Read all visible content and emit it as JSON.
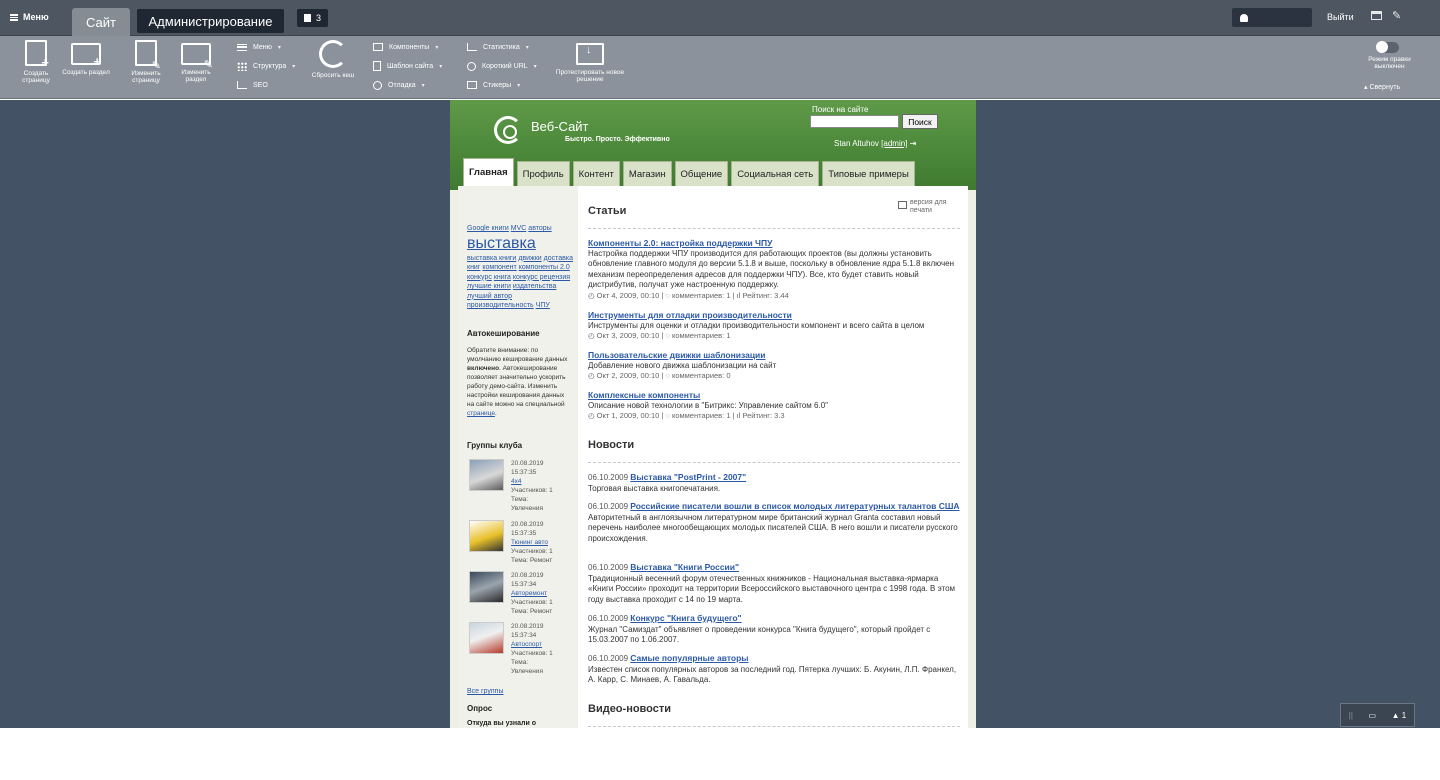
{
  "admin_bar": {
    "menu_label": "Меню",
    "tab_site": "Сайт",
    "tab_admin": "Администрирование",
    "notifications_count": "3",
    "logout": "Выйти"
  },
  "toolbar": {
    "create_page": "Создать страницу",
    "create_section": "Создать раздел",
    "edit_page": "Изменить страницу",
    "edit_section": "Изменить раздел",
    "menu": "Меню",
    "structure": "Структура",
    "seo": "SEO",
    "reset_cache": "Сбросить кеш",
    "components": "Компоненты",
    "site_template": "Шаблон сайта",
    "debug": "Отладка",
    "statistics": "Статистика",
    "short_url": "Короткий URL",
    "stickers": "Стикеры",
    "test_solution": "Протестировать новое решение",
    "edit_mode": "Режим правки выключен",
    "collapse": "Свернуть"
  },
  "site": {
    "name": "Веб-Сайт",
    "slogan": "Быстро. Просто. Эффективно",
    "search_label": "Поиск на сайте",
    "search_button": "Поиск",
    "user_name": "Stan Altuhov",
    "user_login": "[admin]",
    "tabs": [
      "Главная",
      "Профиль",
      "Контент",
      "Магазин",
      "Общение",
      "Социальная сеть",
      "Типовые примеры"
    ]
  },
  "left": {
    "tags_line1": [
      "Google книги",
      "MVC",
      "авторы"
    ],
    "tag_big": "выставка",
    "tags_rest": [
      "выставка книги",
      "движки",
      "доставка книг",
      "компонент",
      "компоненты 2.0",
      "конкурс",
      "книга",
      "конкурс рецензия",
      "лучшие книги",
      "издательства",
      "лучший автор",
      "производительность",
      "ЧПУ"
    ],
    "autocache_title": "Автокеширование",
    "autocache_text_pre": "Обратите внимание: по умолчанию кеширование данных ",
    "autocache_bold": "включено",
    "autocache_text_post": ". Автокеширование позволяет значительно ускорить работу демо-сайта. Изменить настройки кеширования данных на сайте можно на специальной ",
    "autocache_link": "странице",
    "groups_title": "Группы клуба",
    "groups": [
      {
        "date": "20.08.2019",
        "time": "15:37:35",
        "name": "4x4",
        "members": "Участников: 1",
        "theme_label": "Тема:",
        "theme": "Увлечения"
      },
      {
        "date": "20.08.2019",
        "time": "15:37:35",
        "name": "Тюнинг авто",
        "members": "Участников: 1",
        "theme_label": "Тема:",
        "theme": "Ремонт"
      },
      {
        "date": "20.08.2019",
        "time": "15:37:34",
        "name": "Авторемонт",
        "members": "Участников: 1",
        "theme_label": "Тема:",
        "theme": "Ремонт"
      },
      {
        "date": "20.08.2019",
        "time": "15:37:34",
        "name": "Автоспорт",
        "members": "Участников: 1",
        "theme_label": "Тема:",
        "theme": "Увлечения"
      }
    ],
    "all_groups": "Все группы",
    "poll_title": "Опрос",
    "poll_question": "Откуда вы узнали о"
  },
  "right": {
    "articles_title": "Статьи",
    "print_label": "версия для печати",
    "articles": [
      {
        "title": "Компоненты 2.0: настройка поддержки ЧПУ",
        "text": "Настройка поддержки ЧПУ производится для работающих проектов (вы должны установить обновление главного модуля до версии 5.1.8 и выше, поскольку в обновление ядра 5.1.8 включен механизм переопределения адресов для поддержки ЧПУ). Все, кто будет ставить новый дистрибутив, получат уже настроенную поддержку.",
        "meta": "◴ Окт 4, 2009, 00:10 | ◌ комментариев: 1 | ıl Рейтинг: 3.44"
      },
      {
        "title": "Инструменты для отладки производительности",
        "text": "Инструменты для оценки и отладки производительности компонент и всего сайта в целом",
        "meta": "◴ Окт 3, 2009, 00:10 | ◌ комментариев: 1"
      },
      {
        "title": "Пользовательские движки шаблонизации",
        "text": "Добавление нового движка шаблонизации на сайт",
        "meta": "◴ Окт 2, 2009, 00:10 | ◌ комментариев: 0"
      },
      {
        "title": "Комплексные компоненты",
        "text": "Описание новой технологии в \"Битрикс: Управление сайтом 6.0\"",
        "meta": "◴ Окт 1, 2009, 00:10 | ◌ комментариев: 1 | ıl Рейтинг: 3.3"
      }
    ],
    "news_title": "Новости",
    "news": [
      {
        "date": "06.10.2009",
        "title": "Выставка \"PostPrint - 2007\"",
        "text": "Торговая выставка книгопечатания."
      },
      {
        "date": "06.10.2009",
        "title": "Российские писатели вошли в список молодых литературных талантов США",
        "text": "Авторитетный в англоязычном литературном мире британский журнал Granta составил новый перечень наиболее многообещающих молодых писателей США. В него вошли и писатели русского происхождения."
      },
      {
        "date": "06.10.2009",
        "title": "Выставка \"Книги России\"",
        "text": "Традиционный весенний форум отечественных книжников - Национальная выставка-ярмарка «Книги России» проходит на территории Всероссийского выставочного центра с 1998 года. В этом году выставка проходит с 14 по 19 марта."
      },
      {
        "date": "06.10.2009",
        "title": "Конкурс \"Книга будущего\"",
        "text": "Журнал \"Самиздат\" объявляет о проведении конкурса \"Книга будущего\", который пройдет с 15.03.2007 по 1.06.2007."
      },
      {
        "date": "06.10.2009",
        "title": "Самые популярные авторы",
        "text": "Известен список популярных авторов за последний год. Пятерка лучших: Б. Акунин, Л.П. Франкел, А. Карр, С. Минаев, А. Гавальда."
      }
    ],
    "video_title": "Видео-новости"
  },
  "widget": {
    "count": "1"
  }
}
